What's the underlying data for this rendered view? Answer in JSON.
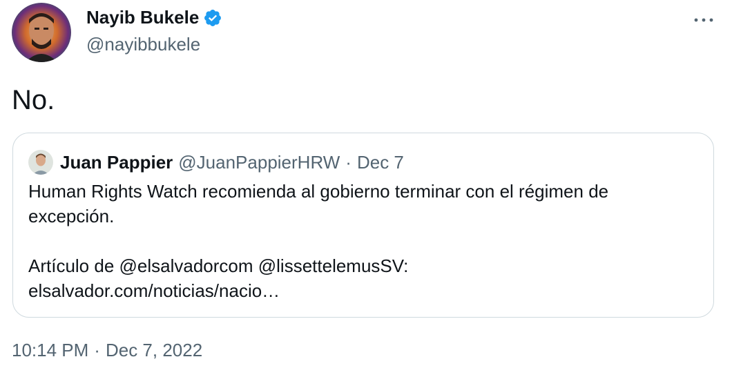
{
  "author": {
    "name": "Nayib Bukele",
    "handle": "@nayibbukele"
  },
  "tweet": {
    "text": "No."
  },
  "quote": {
    "name": "Juan Pappier",
    "handle": "@JuanPappierHRW",
    "separator": "·",
    "date": "Dec 7",
    "line1": "Human Rights Watch recomienda al gobierno terminar con el régimen de",
    "line2": "excepción.",
    "line3": "Artículo de @elsalvadorcom @lissettelemusSV:",
    "line4": "elsalvador.com/noticias/nacio…"
  },
  "footer": {
    "time": "10:14 PM",
    "separator": "·",
    "date": "Dec 7, 2022"
  },
  "colors": {
    "text": "#0f1419",
    "secondary": "#536471",
    "verified": "#1d9bf0",
    "border": "#cfd9de"
  },
  "icons": {
    "verified": "verified-badge-icon",
    "more": "more-horizontal-icon"
  }
}
